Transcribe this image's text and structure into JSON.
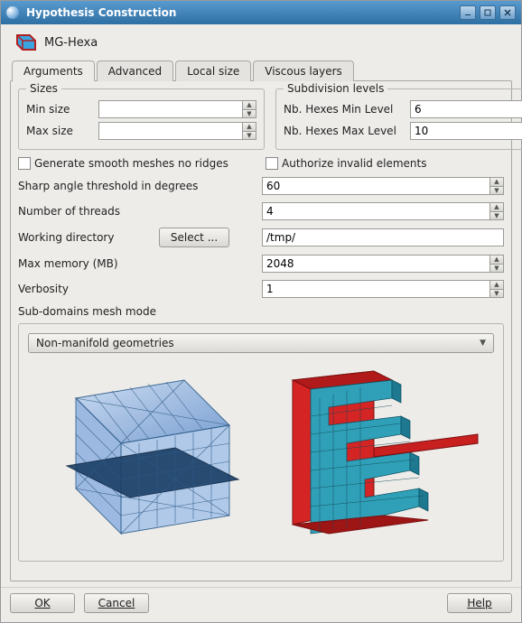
{
  "title": "Hypothesis Construction",
  "hypothesis_name": "MG-Hexa",
  "tabs": [
    "Arguments",
    "Advanced",
    "Local size",
    "Viscous layers"
  ],
  "active_tab": 0,
  "sizes": {
    "legend": "Sizes",
    "min_label": "Min size",
    "max_label": "Max size",
    "min_value": "",
    "max_value": ""
  },
  "subdivision": {
    "legend": "Subdivision levels",
    "min_label": "Nb. Hexes Min Level",
    "max_label": "Nb. Hexes Max Level",
    "min_value": "6",
    "max_value": "10"
  },
  "checks": {
    "smooth_label": "Generate smooth meshes no ridges",
    "authorize_label": "Authorize invalid elements"
  },
  "params": {
    "sharp_angle_label": "Sharp angle threshold in degrees",
    "sharp_angle_value": "60",
    "threads_label": "Number of threads",
    "threads_value": "4",
    "workdir_label": "Working directory",
    "workdir_value": "/tmp/",
    "select_label": "Select ...",
    "maxmem_label": "Max memory (MB)",
    "maxmem_value": "2048",
    "verbosity_label": "Verbosity",
    "verbosity_value": "1"
  },
  "subdomains": {
    "legend": "Sub-domains mesh mode",
    "mode": "Non-manifold geometries"
  },
  "buttons": {
    "ok": "OK",
    "cancel": "Cancel",
    "help": "Help"
  },
  "icons": {
    "min": "minimize",
    "max": "maximize",
    "close": "close"
  }
}
